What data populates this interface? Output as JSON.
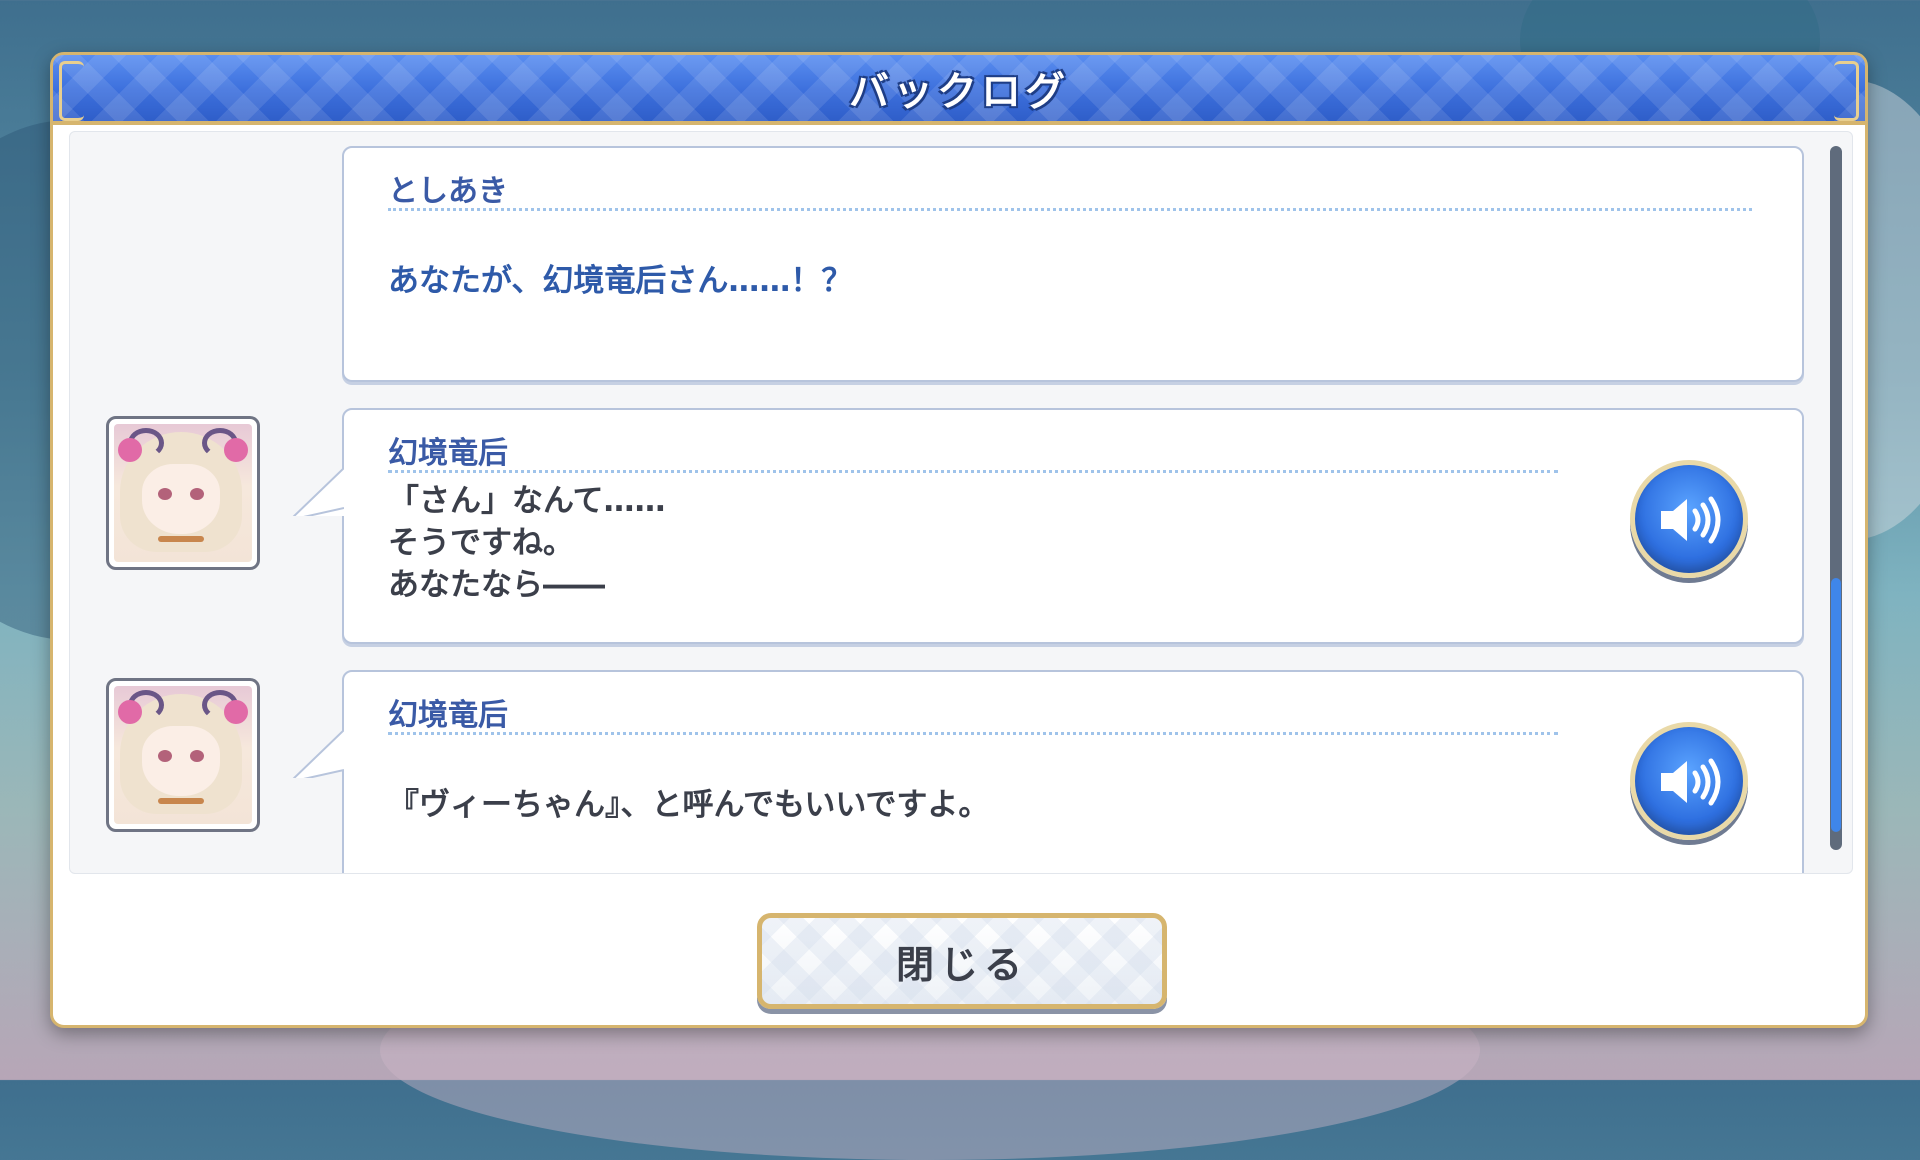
{
  "window": {
    "title": "バックログ"
  },
  "entries": [
    {
      "speaker": "としあき",
      "text": "あなたが、幻境竜后さん……！？",
      "has_avatar": false,
      "has_voice": false
    },
    {
      "speaker": "幻境竜后",
      "text": "「さん」なんて……\nそうですね。\nあなたなら――",
      "has_avatar": true,
      "has_voice": true
    },
    {
      "speaker": "幻境竜后",
      "text": "『ヴィーちゃん』、と呼んでもいいですよ。",
      "has_avatar": true,
      "has_voice": true
    }
  ],
  "footer": {
    "close_label": "閉じる"
  },
  "icons": {
    "voice": "speaker-icon",
    "avatar": "character-portrait"
  },
  "colors": {
    "title_bar": "#3c6fdc",
    "frame_gold": "#d6b56e",
    "speaker_name": "#3a5aa6",
    "message_text": "#3b3f4a",
    "scroll_thumb": "#3f86ea"
  }
}
